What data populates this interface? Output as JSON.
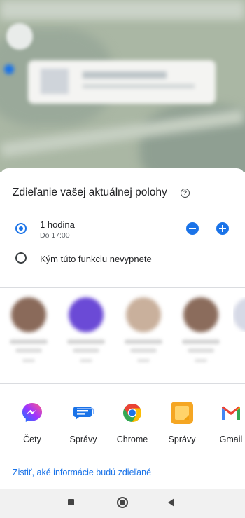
{
  "sheet": {
    "title": "Zdieľanie vašej aktuálnej polohy",
    "options": [
      {
        "label": "1 hodina",
        "sub": "Do 17:00",
        "selected": true
      },
      {
        "label": "Kým túto funkciu nevypnete",
        "selected": false
      }
    ],
    "actions": {
      "minus": "remove",
      "plus": "add"
    },
    "link": "Zistiť, aké informácie budú zdieľané"
  },
  "apps": [
    {
      "label": "Čety",
      "icon": "messenger-icon"
    },
    {
      "label": "Správy",
      "icon": "google-messages-icon"
    },
    {
      "label": "Chrome",
      "icon": "chrome-icon"
    },
    {
      "label": "Správy",
      "icon": "notes-app-icon"
    },
    {
      "label": "Gmail",
      "icon": "gmail-icon"
    }
  ],
  "colors": {
    "accent": "#1a73e8",
    "text": "#202124",
    "secondary": "#5f6368"
  }
}
